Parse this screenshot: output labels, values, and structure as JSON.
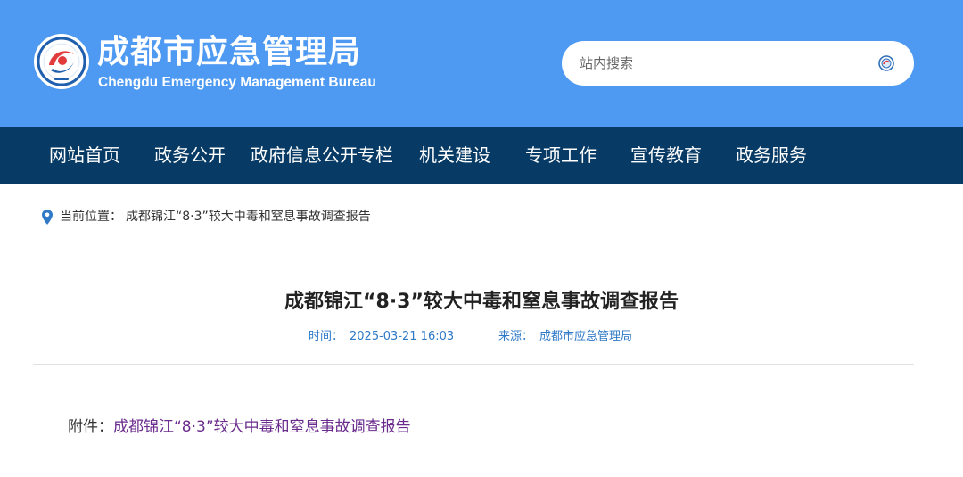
{
  "header": {
    "site_name": "成都市应急管理局",
    "site_name_en": "Chengdu Emergency Management Bureau",
    "logo_icon": "emergency-bureau-emblem",
    "search": {
      "placeholder": "站内搜索",
      "value": "",
      "button_icon": "search-icon"
    }
  },
  "nav": {
    "items": [
      {
        "label": "网站首页"
      },
      {
        "label": "政务公开"
      },
      {
        "label": "政府信息公开专栏"
      },
      {
        "label": "机关建设"
      },
      {
        "label": "专项工作"
      },
      {
        "label": "宣传教育"
      },
      {
        "label": "政务服务"
      }
    ]
  },
  "breadcrumb": {
    "icon": "location-pin-icon",
    "label": "当前位置：",
    "current": "成都锦江“8·3”较大中毒和窒息事故调查报告"
  },
  "article": {
    "title": "成都锦江“8·3”较大中毒和窒息事故调查报告",
    "time_label": "时间：",
    "time_value": "2025-03-21 16:03",
    "source_label": "来源：",
    "source_value": "成都市应急管理局",
    "attachment_label": "附件：",
    "attachment_link": "成都锦江“8·3”较大中毒和窒息事故调查报告"
  },
  "colors": {
    "header_bg": "#4e9af2",
    "nav_bg": "#073a64",
    "meta_text": "#2f79c7",
    "link": "#6a2b8d"
  }
}
